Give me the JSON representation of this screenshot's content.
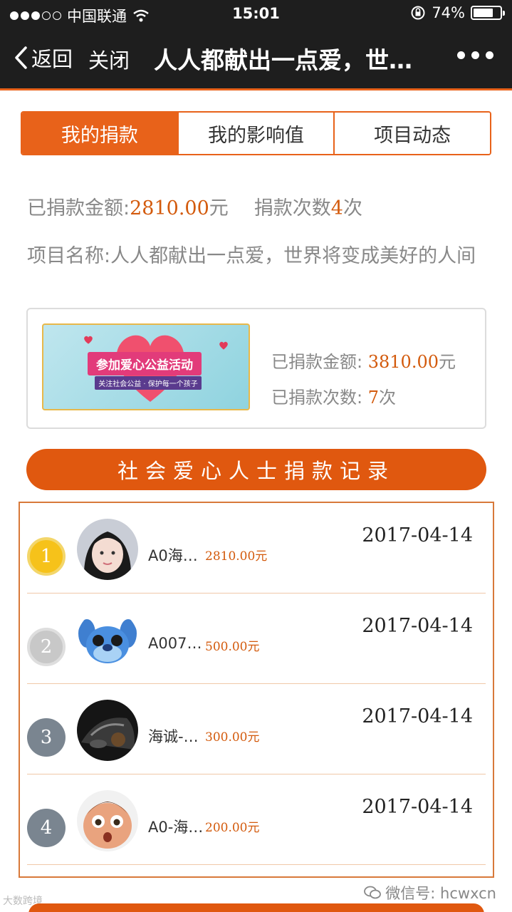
{
  "status_bar": {
    "carrier": "中国联通",
    "time": "15:01",
    "battery_percent": "74%",
    "battery_level": 0.74
  },
  "nav": {
    "back_label": "返回",
    "close_label": "关闭",
    "title": "人人都献出一点爱，世界将变成美好的人间"
  },
  "tabs": [
    {
      "label": "我的捐款",
      "active": true
    },
    {
      "label": "我的影响值",
      "active": false
    },
    {
      "label": "项目动态",
      "active": false
    }
  ],
  "summary": {
    "donated_label": "已捐款金额:",
    "donated_value": "2810.00",
    "donated_unit": "元",
    "count_label": "捐款次数",
    "count_value": "4",
    "count_unit": "次"
  },
  "project": {
    "name_label": "项目名称:",
    "name": "人人都献出一点爱，世界将变成美好的人间"
  },
  "card": {
    "banner_title": "参加爱心公益活动",
    "banner_subtitle": "关注社会公益 · 保护每一个孩子",
    "amount_label": "已捐款金额:",
    "amount_value": "3810.00",
    "amount_unit": "元",
    "count_label": "已捐款次数:",
    "count_value": "7",
    "count_unit": "次"
  },
  "section_button": {
    "label": "社会爱心人士捐款记录"
  },
  "records": [
    {
      "rank": "1",
      "name": "A0海…",
      "amount": "2810.00元",
      "date": "2017-04-14",
      "medal": "gold"
    },
    {
      "rank": "2",
      "name": "A007…",
      "amount": "500.00元",
      "date": "2017-04-14",
      "medal": "silver"
    },
    {
      "rank": "3",
      "name": "海诚-…",
      "amount": "300.00元",
      "date": "2017-04-14",
      "medal": "plain"
    },
    {
      "rank": "4",
      "name": "A0-海…",
      "amount": "200.00元",
      "date": "2017-04-14",
      "medal": "plain"
    }
  ],
  "footer": {
    "watermark": "大数跨境",
    "wechat": "微信号: hcwxcn"
  },
  "colors": {
    "accent": "#e8621a",
    "amount": "#d35a0c",
    "nav_bg": "#1e1e1e"
  }
}
